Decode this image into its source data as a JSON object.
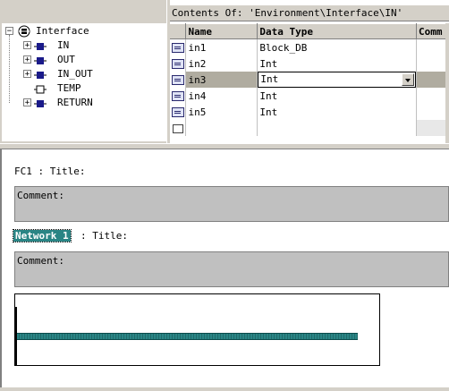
{
  "contents_header": "Contents Of: 'Environment\\Interface\\IN'",
  "tree": {
    "root": "Interface",
    "items": [
      {
        "label": "IN",
        "expandable": true
      },
      {
        "label": "OUT",
        "expandable": true
      },
      {
        "label": "IN_OUT",
        "expandable": true
      },
      {
        "label": "TEMP",
        "expandable": false
      },
      {
        "label": "RETURN",
        "expandable": true
      }
    ]
  },
  "grid": {
    "columns": [
      "Name",
      "Data Type",
      "Comm"
    ],
    "rows": [
      {
        "name": "in1",
        "type": "Block_DB"
      },
      {
        "name": "in2",
        "type": "Int"
      },
      {
        "name": "in3",
        "type": "Int"
      },
      {
        "name": "in4",
        "type": "Int"
      },
      {
        "name": "in5",
        "type": "Int"
      }
    ]
  },
  "block": {
    "title_line": "FC1 : Title:",
    "comment_label": "Comment:"
  },
  "network": {
    "label": "Network 1",
    "title_label": ": Title:",
    "comment_label": "Comment:"
  },
  "colors": {
    "chrome": "#d4d0c8",
    "accent_teal": "#2a8585",
    "comment_gray": "#c0c0c0"
  }
}
